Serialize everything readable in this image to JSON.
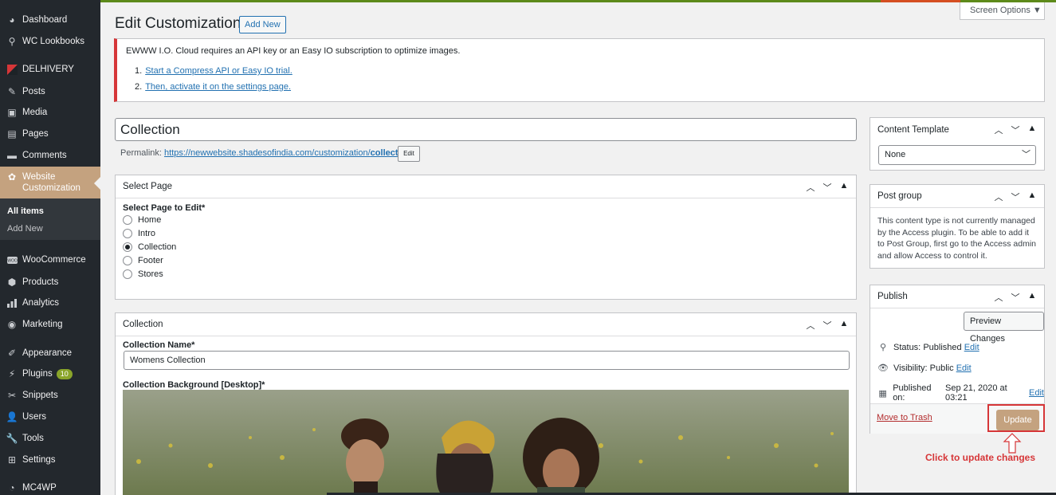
{
  "sidebar": {
    "items": [
      {
        "label": "Dashboard",
        "icon": "dashboard-icon"
      },
      {
        "label": "WC Lookbooks",
        "icon": "pin-icon"
      },
      {
        "label": "DELHIVERY",
        "icon": "delhivery-logo-icon"
      },
      {
        "label": "Posts",
        "icon": "pin-icon"
      },
      {
        "label": "Media",
        "icon": "media-icon"
      },
      {
        "label": "Pages",
        "icon": "pages-icon"
      },
      {
        "label": "Comments",
        "icon": "comment-icon"
      },
      {
        "label": "Website Customization",
        "icon": "customization-icon"
      },
      {
        "label": "WooCommerce",
        "icon": "woocommerce-icon"
      },
      {
        "label": "Products",
        "icon": "products-icon"
      },
      {
        "label": "Analytics",
        "icon": "analytics-icon"
      },
      {
        "label": "Marketing",
        "icon": "marketing-icon"
      },
      {
        "label": "Appearance",
        "icon": "appearance-icon"
      },
      {
        "label": "Plugins",
        "icon": "plugins-icon",
        "badge": "10"
      },
      {
        "label": "Snippets",
        "icon": "snippets-icon"
      },
      {
        "label": "Users",
        "icon": "users-icon"
      },
      {
        "label": "Tools",
        "icon": "tools-icon"
      },
      {
        "label": "Settings",
        "icon": "settings-icon"
      },
      {
        "label": "MC4WP",
        "icon": "mc4wp-icon"
      }
    ],
    "submenu": {
      "all_items": "All items",
      "add_new": "Add New"
    }
  },
  "header": {
    "title": "Edit Customization",
    "add_new": "Add New",
    "screen_options": "Screen Options ▼"
  },
  "notice": {
    "text": "EWWW I.O. Cloud requires an API key or an Easy IO subscription to optimize images.",
    "steps": [
      {
        "num": "1.",
        "link": "Start a Compress API or Easy IO trial."
      },
      {
        "num": "2.",
        "link": "Then, activate it on the settings page."
      }
    ]
  },
  "post": {
    "title": "Collection",
    "permalink_label": "Permalink:",
    "permalink_base": "https://newwebsite.shadesofindia.com/customization/",
    "permalink_slug": "collection",
    "permalink_end": "/",
    "edit_label": "Edit"
  },
  "select_page": {
    "title": "Select Page",
    "field_label": "Select Page to Edit*",
    "options": [
      "Home",
      "Intro",
      "Collection",
      "Footer",
      "Stores"
    ],
    "selected": "Collection"
  },
  "collection_box": {
    "title": "Collection",
    "name_label": "Collection Name*",
    "name_value": "Womens Collection",
    "bg_label": "Collection Background [Desktop]*"
  },
  "content_template": {
    "title": "Content Template",
    "value": "None"
  },
  "post_group": {
    "title": "Post group",
    "text": "This content type is not currently managed by the Access plugin. To be able to add it to Post Group, first go to the Access admin and allow Access to control it."
  },
  "publish": {
    "title": "Publish",
    "preview": "Preview Changes",
    "status_label": "Status:",
    "status_value": "Published",
    "visibility_label": "Visibility:",
    "visibility_value": "Public",
    "published_label": "Published on:",
    "published_value": "Sep 21, 2020 at 03:21",
    "edit": "Edit",
    "trash": "Move to Trash",
    "update": "Update"
  },
  "annotation": {
    "hint": "Click to update changes",
    "color": "#d63638"
  },
  "colors": {
    "sidebar": "#23282d",
    "active": "#c4a27f",
    "link": "#2271b1"
  }
}
